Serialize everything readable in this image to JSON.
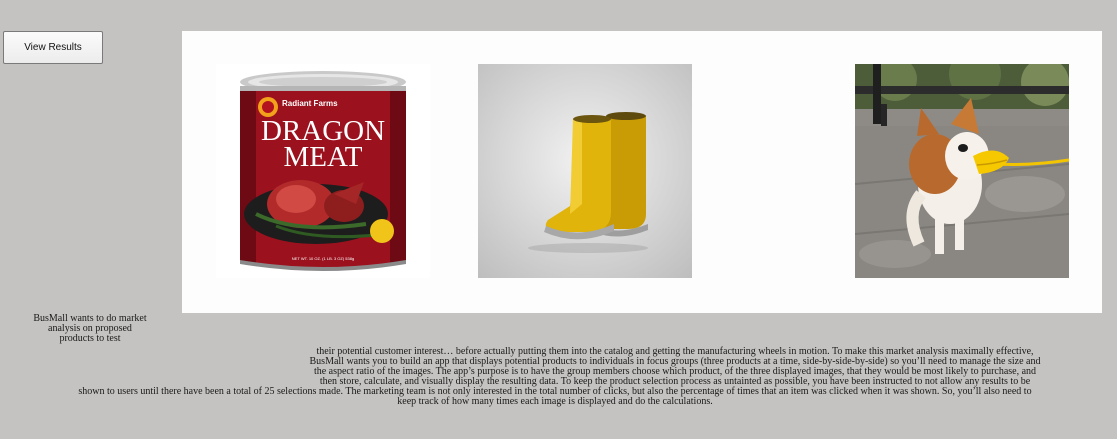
{
  "toolbar": {
    "view_results_label": "View Results"
  },
  "products": [
    {
      "name": "dragon-meat",
      "brand": "Radiant Farms",
      "title_line1": "DRAGON",
      "title_line2": "MEAT",
      "net_wt": "NET WT. 10 OZ. (1 LB. 3 OZ) 538g"
    },
    {
      "name": "rain-boots"
    },
    {
      "name": "dog-duck-muzzle"
    }
  ],
  "intro": {
    "side_text": "BusMall wants to do market analysis on proposed products to test",
    "lines": [
      "their potential customer interest… before actually putting them into the catalog and getting the manufacturing wheels in motion. To make this market analysis maximally effective,",
      "BusMall wants you to build an app that displays potential products to individuals in focus groups (three products at a time, side-by-side-by-side) so you’ll need to manage the size and",
      "the aspect ratio of the images. The app’s purpose is to have the group members choose which product, of the three displayed images, that they would be most likely to purchase, and",
      "then store, calculate, and visually display the resulting data. To keep the product selection process as untainted as possible, you have been instructed to not allow any results to be",
      "shown to users until there have been a total of 25 selections made. The marketing team is not only interested in the total number of clicks, but also the percentage of times that an item was clicked when it was shown. So, you’ll also need to",
      "keep track of how many times each image is displayed and do the calculations."
    ]
  }
}
